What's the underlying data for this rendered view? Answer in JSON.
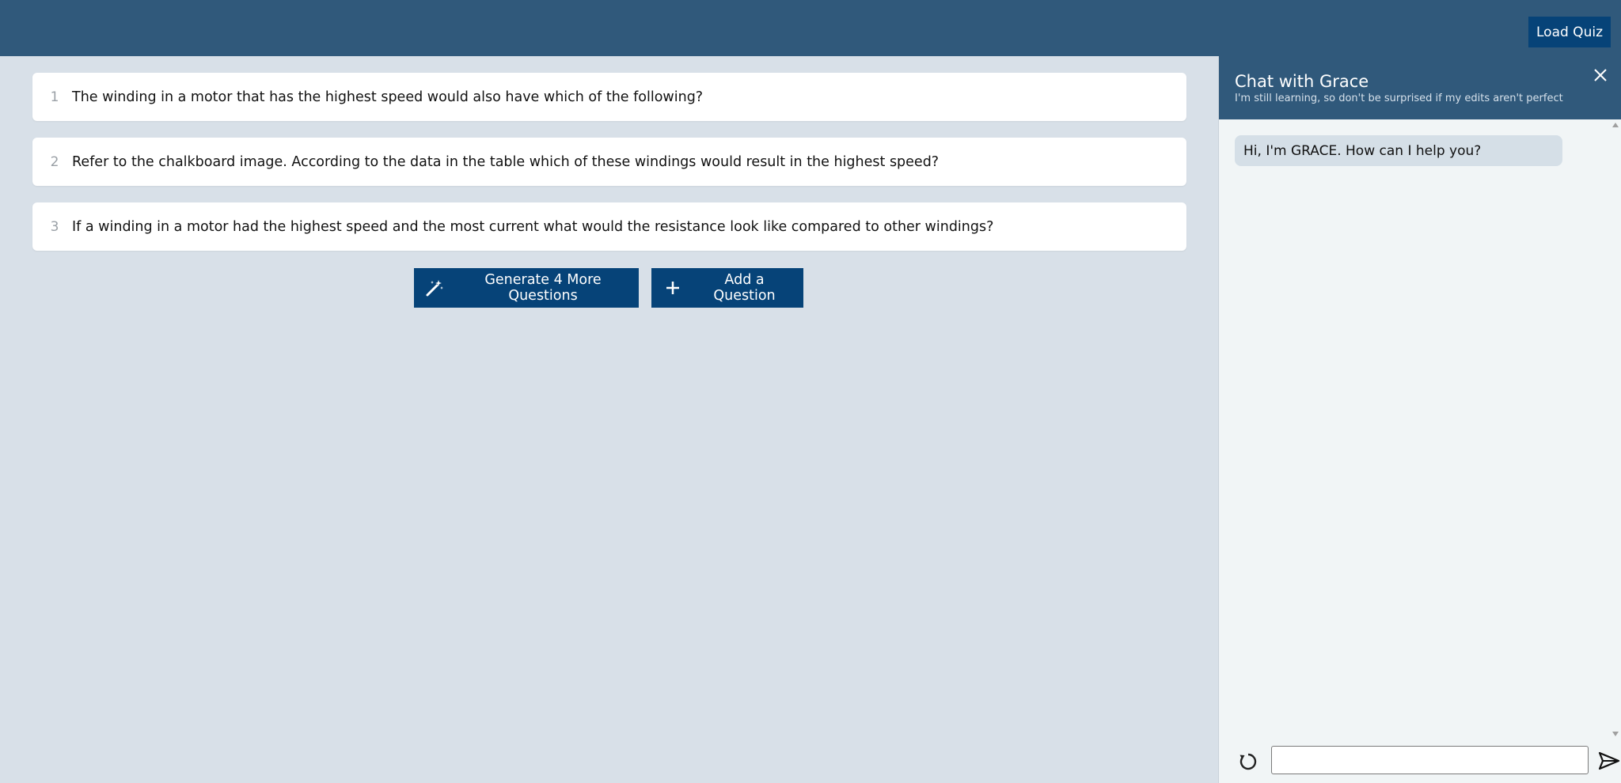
{
  "header": {
    "load_quiz_label": "Load Quiz"
  },
  "questions": [
    {
      "number": "1",
      "text": "The winding in a motor that has the highest speed would also have which of the following?"
    },
    {
      "number": "2",
      "text": "Refer to the chalkboard image. According to the data in the table which of these windings would result in the highest speed?"
    },
    {
      "number": "3",
      "text": "If a winding in a motor had the highest speed and the most current what would the resistance look like compared to other windings?"
    }
  ],
  "actions": {
    "generate_label": "Generate 4 More Questions",
    "generate_icon": "magic-wand-icon",
    "add_label": "Add a Question",
    "add_icon": "plus-icon"
  },
  "chat": {
    "title": "Chat with Grace",
    "subtitle": "I'm still learning, so don't be surprised if my edits aren't perfect",
    "close_icon": "close-icon",
    "messages": [
      {
        "from": "assistant",
        "text": "Hi, I'm GRACE. How can I help you?"
      }
    ],
    "input_value": "",
    "reset_icon": "refresh-icon",
    "send_icon": "send-icon"
  },
  "colors": {
    "topbar": "#30597b",
    "button": "#064378",
    "background": "#d8e0e8",
    "chat_background": "#f1f5f6",
    "bubble": "#d5dfe7"
  }
}
